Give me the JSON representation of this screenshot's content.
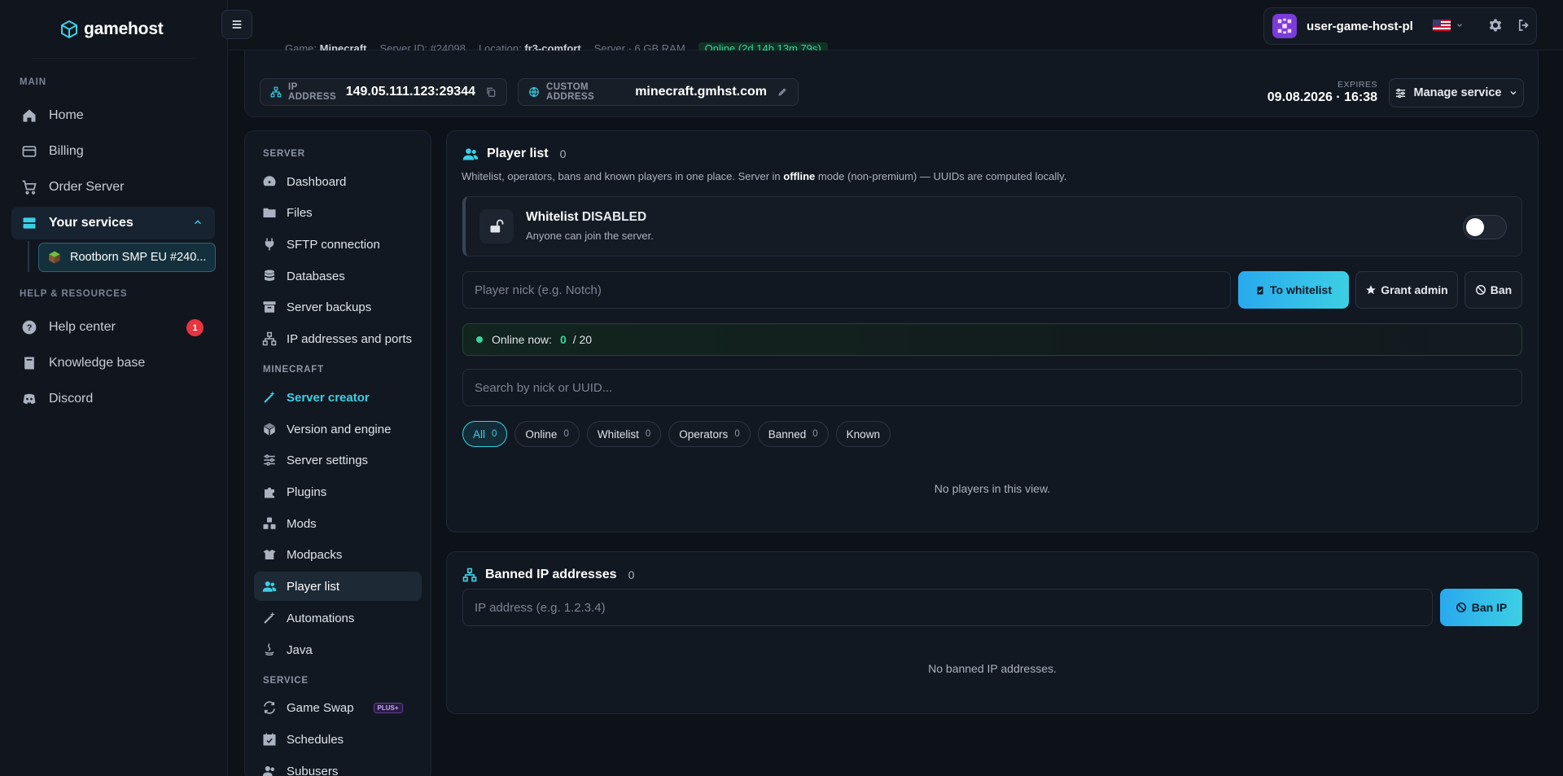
{
  "brand": {
    "name": "gamehost"
  },
  "sidebar": {
    "sections": [
      "MAIN",
      "HELP & RESOURCES"
    ],
    "main_items": [
      {
        "label": "Home",
        "icon": "home-icon"
      },
      {
        "label": "Billing",
        "icon": "billing-icon"
      },
      {
        "label": "Order Server",
        "icon": "cart-icon"
      },
      {
        "label": "Your services",
        "icon": "services-icon"
      }
    ],
    "service_item": "Rootborn SMP EU #240...",
    "help_items": [
      {
        "label": "Help center",
        "icon": "help-icon",
        "badge": "1"
      },
      {
        "label": "Knowledge base",
        "icon": "book-icon"
      },
      {
        "label": "Discord",
        "icon": "discord-icon"
      }
    ]
  },
  "header": {
    "status": {
      "game_label": "Game:",
      "game": "Minecraft",
      "server_id": "Server ID: #24098",
      "location_label": "Location:",
      "location": "fr3-comfort",
      "ram": "Server · 6 GB RAM",
      "online": "Online (2d 14h 13m 79s)"
    },
    "user": {
      "name": "user-game-host-pl"
    }
  },
  "address": {
    "ip_label": "IP ADDRESS",
    "ip": "149.05.111.123:29344",
    "custom_label": "CUSTOM ADDRESS",
    "custom": "minecraft.gmhst.com",
    "expires_label": "EXPIRES",
    "expires": "09.08.2026 · 16:38",
    "manage_label": "Manage service"
  },
  "nav": {
    "server_section": "SERVER",
    "server_items": [
      "Dashboard",
      "Files",
      "SFTP connection",
      "Databases",
      "Server backups",
      "IP addresses and ports"
    ],
    "minecraft_section": "MINECRAFT",
    "minecraft_items": [
      "Server creator",
      "Version and engine",
      "Server settings",
      "Plugins",
      "Mods",
      "Modpacks",
      "Player list",
      "Automations",
      "Java"
    ],
    "service_section": "SERVICE",
    "service_items": [
      "Game Swap",
      "Schedules",
      "Subusers"
    ],
    "plus_badge": "PLUS+"
  },
  "player_list": {
    "title": "Player list",
    "count": "0",
    "desc_pre": "Whitelist, operators, bans and known players in one place. Server in ",
    "desc_bold": "offline",
    "desc_post": " mode (non-premium) — UUIDs are computed locally.",
    "whitelist_title": "Whitelist",
    "whitelist_state": "DISABLED",
    "whitelist_sub": "Anyone can join the server.",
    "nick_placeholder": "Player nick (e.g. Notch)",
    "btn_whitelist": "To whitelist",
    "btn_admin": "Grant admin",
    "btn_ban": "Ban",
    "online_label": "Online now:",
    "online_count": "0",
    "online_max": "/ 20",
    "search_placeholder": "Search by nick or UUID...",
    "filters": [
      {
        "label": "All",
        "count": "0"
      },
      {
        "label": "Online",
        "count": "0"
      },
      {
        "label": "Whitelist",
        "count": "0"
      },
      {
        "label": "Operators",
        "count": "0"
      },
      {
        "label": "Banned",
        "count": "0"
      },
      {
        "label": "Known",
        "count": ""
      }
    ],
    "empty": "No players in this view."
  },
  "banned_ips": {
    "title": "Banned IP addresses",
    "count": "0",
    "ip_placeholder": "IP address (e.g. 1.2.3.4)",
    "btn_ban_ip": "Ban IP",
    "empty": "No banned IP addresses."
  },
  "colors": {
    "accent": "#3ccfe4",
    "online": "#37d69d",
    "badge": "#e8343f",
    "bg": "#0d1118"
  }
}
